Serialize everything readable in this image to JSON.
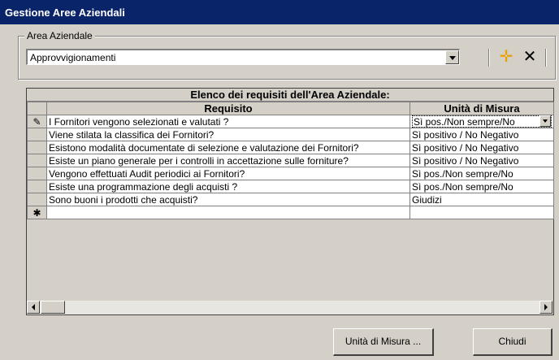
{
  "window": {
    "title": "Gestione Aree Aziendali"
  },
  "area": {
    "group_label": "Area Aziendale",
    "selected": "Approvvigionamenti"
  },
  "toolbar": {
    "add_icon": "add-icon",
    "delete_icon": "delete-icon"
  },
  "grid": {
    "caption": "Elenco dei requisiti dell'Area Aziendale:",
    "columns": [
      "Requisito",
      "Unità di Misura"
    ],
    "rows": [
      {
        "requisito": "I Fornitori vengono selezionati e valutati ?",
        "unita": "Sì pos./Non sempre/No"
      },
      {
        "requisito": "Viene stilata la classifica dei Fornitori?",
        "unita": "Sì positivo / No Negativo"
      },
      {
        "requisito": "Esistono modalità documentate di selezione e valutazione dei Fornitori?",
        "unita": "Sì positivo / No Negativo"
      },
      {
        "requisito": "Esiste un piano generale per i controlli in accettazione sulle forniture?",
        "unita": "Sì positivo / No Negativo"
      },
      {
        "requisito": "Vengono effettuati Audit periodici ai Fornitori?",
        "unita": "Sì pos./Non sempre/No"
      },
      {
        "requisito": "Esiste una programmazione degli acquisti ?",
        "unita": "Sì pos./Non sempre/No"
      },
      {
        "requisito": "Sono buoni i prodotti che acquisti?",
        "unita": "Giudizi"
      }
    ],
    "current_row_marker": "✎",
    "new_row_marker": "✱"
  },
  "buttons": {
    "unita_misura": "Unità di Misura ...",
    "chiudi": "Chiudi"
  }
}
